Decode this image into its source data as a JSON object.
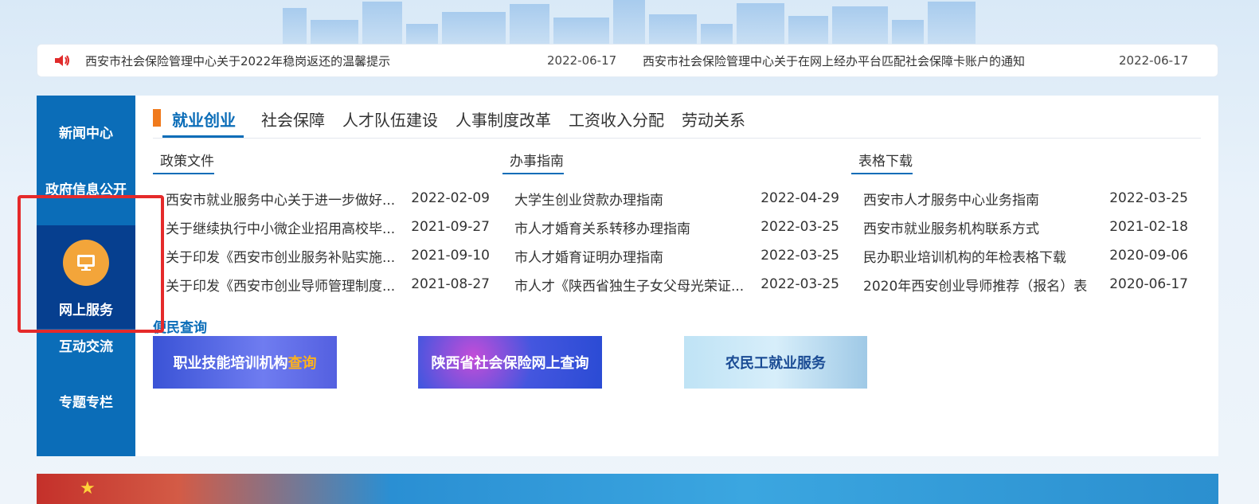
{
  "notice": {
    "items": [
      {
        "title": "西安市社会保险管理中心关于2022年稳岗返还的温馨提示",
        "date": "2022-06-17"
      },
      {
        "title": "西安市社会保险管理中心关于在网上经办平台匹配社会保障卡账户的通知",
        "date": "2022-06-17"
      }
    ]
  },
  "sidebar": {
    "items": [
      {
        "label": "新闻中心"
      },
      {
        "label": "政府信息公开"
      },
      {
        "label": "网上服务"
      },
      {
        "label": "互动交流"
      },
      {
        "label": "专题专栏"
      }
    ]
  },
  "tabs": [
    {
      "label": "就业创业"
    },
    {
      "label": "社会保障"
    },
    {
      "label": "人才队伍建设"
    },
    {
      "label": "人事制度改革"
    },
    {
      "label": "工资收入分配"
    },
    {
      "label": "劳动关系"
    }
  ],
  "columns": [
    {
      "title": "政策文件",
      "rows": [
        {
          "title": "西安市就业服务中心关于进一步做好...",
          "date": "2022-02-09"
        },
        {
          "title": "关于继续执行中小微企业招用高校毕...",
          "date": "2021-09-27"
        },
        {
          "title": "关于印发《西安市创业服务补贴实施...",
          "date": "2021-09-10"
        },
        {
          "title": "关于印发《西安市创业导师管理制度...",
          "date": "2021-08-27"
        }
      ]
    },
    {
      "title": "办事指南",
      "rows": [
        {
          "title": "大学生创业贷款办理指南",
          "date": "2022-04-29"
        },
        {
          "title": "市人才婚育关系转移办理指南",
          "date": "2022-03-25"
        },
        {
          "title": "市人才婚育证明办理指南",
          "date": "2022-03-25"
        },
        {
          "title": "市人才《陕西省独生子女父母光荣证...",
          "date": "2022-03-25"
        }
      ]
    },
    {
      "title": "表格下载",
      "rows": [
        {
          "title": "西安市人才服务中心业务指南",
          "date": "2022-03-25"
        },
        {
          "title": "西安市就业服务机构联系方式",
          "date": "2021-02-18"
        },
        {
          "title": "民办职业培训机构的年检表格下载",
          "date": "2020-09-06"
        },
        {
          "title": "2020年西安创业导师推荐（报名）表",
          "date": "2020-06-17"
        }
      ]
    }
  ],
  "convenience": {
    "title": "便民查询",
    "banners": [
      {
        "text": "职业技能培训机构",
        "highlight": "查询"
      },
      {
        "text": "陕西省社会保险网上查询"
      },
      {
        "text": "农民工就业服务"
      }
    ]
  },
  "colors": {
    "primary": "#0b6db8",
    "sidebar_active": "#063f8f",
    "accent_orange": "#f07a1c",
    "annotation_red": "#e52a2a"
  }
}
